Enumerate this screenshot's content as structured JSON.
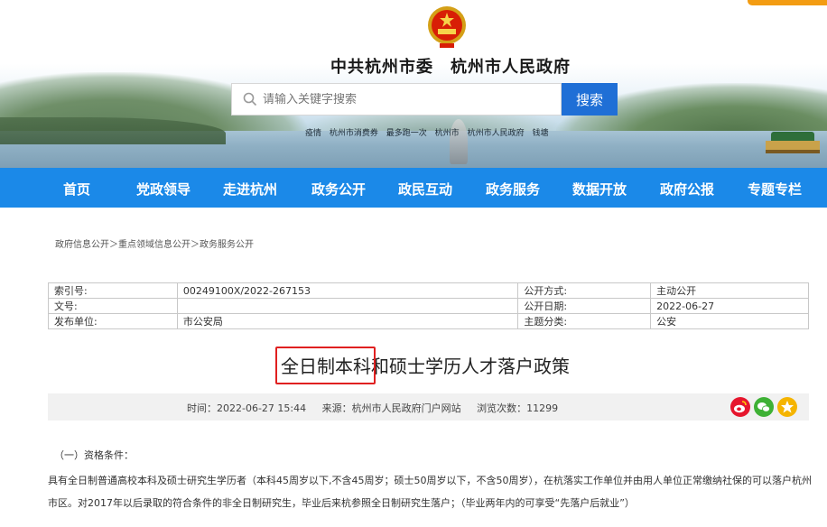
{
  "header": {
    "site_title": "中共杭州市委　杭州市人民政府",
    "search_placeholder": "请输入关键字搜索",
    "search_button": "搜索",
    "hot_words": [
      "疫情",
      "杭州市消费券",
      "最多跑一次",
      "杭州市",
      "杭州市人民政府",
      "钱塘"
    ]
  },
  "nav": {
    "items": [
      "首页",
      "党政领导",
      "走进杭州",
      "政务公开",
      "政民互动",
      "政务服务",
      "数据开放",
      "政府公报",
      "专题专栏"
    ]
  },
  "breadcrumb": "政府信息公开＞重点领域信息公开＞政务服务公开",
  "meta": {
    "rows": [
      [
        "索引号:",
        "00249100X/2022-267153",
        "公开方式:",
        "主动公开"
      ],
      [
        "文号:",
        "",
        "公开日期:",
        "2022-06-27"
      ],
      [
        "发布单位:",
        "市公安局",
        "主题分类:",
        "公安"
      ]
    ]
  },
  "article": {
    "title": "全日制本科和硕士学历人才落户政策",
    "time": "时间：2022-06-27 15:44",
    "source": "来源：杭州市人民政府门户网站",
    "views": "浏览次数：11299",
    "section_heading": "（一）资格条件：",
    "body": "具有全日制普通高校本科及硕士研究生学历者（本科45周岁以下,不含45周岁；硕士50周岁以下，不含50周岁），在杭落实工作单位并由用人单位正常缴纳社保的可以落户杭州市区。对2017年以后录取的符合条件的非全日制研究生，毕业后来杭参照全日制研究生落户；（毕业两年内的可享受“先落户后就业”）"
  },
  "share": {
    "icons": [
      "weibo-icon",
      "wechat-icon",
      "qzone-icon"
    ],
    "colors": [
      "#e6162d",
      "#3eb135",
      "#f5b400"
    ]
  },
  "colors": {
    "nav_bg": "#1b89e8",
    "search_button_bg": "#1f6fd6",
    "highlight": "#e02020"
  }
}
